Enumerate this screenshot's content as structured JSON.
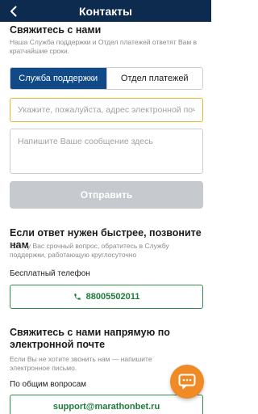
{
  "header": {
    "title": "Контакты",
    "back_icon": "chevron-left-icon"
  },
  "section_write": {
    "title": "Свяжитесь с нами",
    "subtitle": "Наша Служба поддержки и Отдел платежей ответят Вам в кратчайшие сроки.",
    "tabs": [
      {
        "label": "Служба поддержки",
        "active": true
      },
      {
        "label": "Отдел платежей",
        "active": false
      }
    ],
    "email_placeholder": "Укажите, пожалуйста, адрес электронной почты",
    "message_placeholder": "Напишите Ваше сообщение здесь",
    "send_label": "Отправить"
  },
  "section_call": {
    "title": "Если ответ нужен быстрее, позвоните нам",
    "subtitle": "Если у Вас срочный вопрос, обратитесь в Службу поддержки, работающую круглосуточно",
    "phone_label": "Бесплатный телефон",
    "phone_number": "88005502011",
    "phone_icon": "phone-icon"
  },
  "section_email": {
    "title": "Свяжитесь с нами напрямую по электронной почте",
    "subtitle": "Если Вы не хотите звонить нам — напишите электронное письмо.",
    "general_label": "По общим вопросам",
    "general_email": "support@marathonbet.ru"
  },
  "chat": {
    "icon": "chat-icon"
  },
  "colors": {
    "header_bg": "#0d2b4e",
    "tab_active_bg": "#114a87",
    "input_focus_border": "#e8b530",
    "send_disabled_bg": "#c6c9cd",
    "link_green": "#1e7a3b",
    "fab_orange": "#f08a24"
  }
}
